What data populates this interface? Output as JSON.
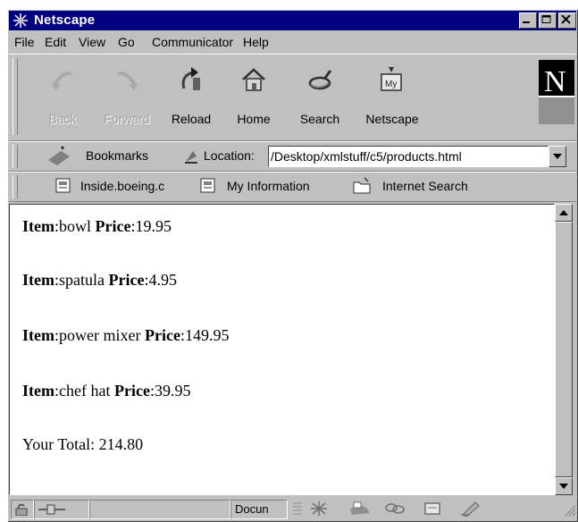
{
  "window": {
    "title": "Netscape"
  },
  "menu": [
    "File",
    "Edit",
    "View",
    "Go",
    "Communicator",
    "Help"
  ],
  "nav": {
    "back": "Back",
    "forward": "Forward",
    "reload": "Reload",
    "home": "Home",
    "search": "Search",
    "netscape": "Netscape",
    "logo_letter": "N"
  },
  "location": {
    "bookmarks_label": "Bookmarks",
    "location_label": "Location:",
    "url": "/Desktop/xmlstuff/c5/products.html"
  },
  "personal": {
    "item1": "Inside.boeing.c",
    "item2": "My Information",
    "item3": "Internet Search"
  },
  "page": {
    "item_label": "Item",
    "price_label": "Price",
    "items": [
      {
        "name": "bowl",
        "price": "19.95"
      },
      {
        "name": "spatula",
        "price": "4.95"
      },
      {
        "name": "power mixer",
        "price": "149.95"
      },
      {
        "name": "chef hat",
        "price": "39.95"
      }
    ],
    "total": "Your Total: 214.80"
  },
  "status": {
    "doc": "Docun"
  }
}
